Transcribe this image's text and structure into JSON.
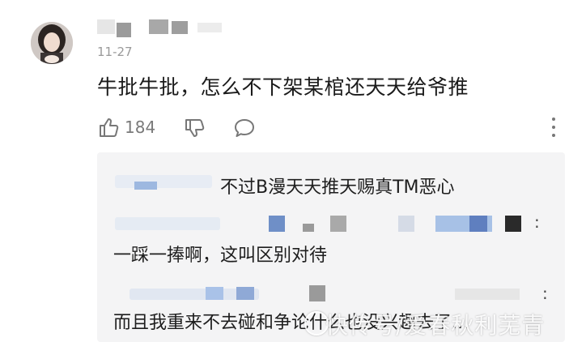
{
  "comment": {
    "date": "11-27",
    "text": "牛批牛批，怎么不下架某棺还天天给爷推",
    "like_count": "184"
  },
  "icons": [
    "thumbs-up-icon",
    "thumbs-down-icon",
    "reply-bubble-icon",
    "more-vertical-icon"
  ],
  "replies": [
    {
      "text": "不过B漫天天推天赐真TM恶心"
    },
    {
      "text": "一踩一捧啊，这叫区别对待"
    },
    {
      "text": "而且我重来不去碰和争论什么也没兴趣去了..."
    }
  ],
  "reply_more_glyph": ":",
  "watermark": "快传号/爱春秋利芜青",
  "colors": {
    "reply_bg": "#f4f4f5",
    "meta_gray": "#9a9a9a",
    "text": "#1a1a1a"
  }
}
